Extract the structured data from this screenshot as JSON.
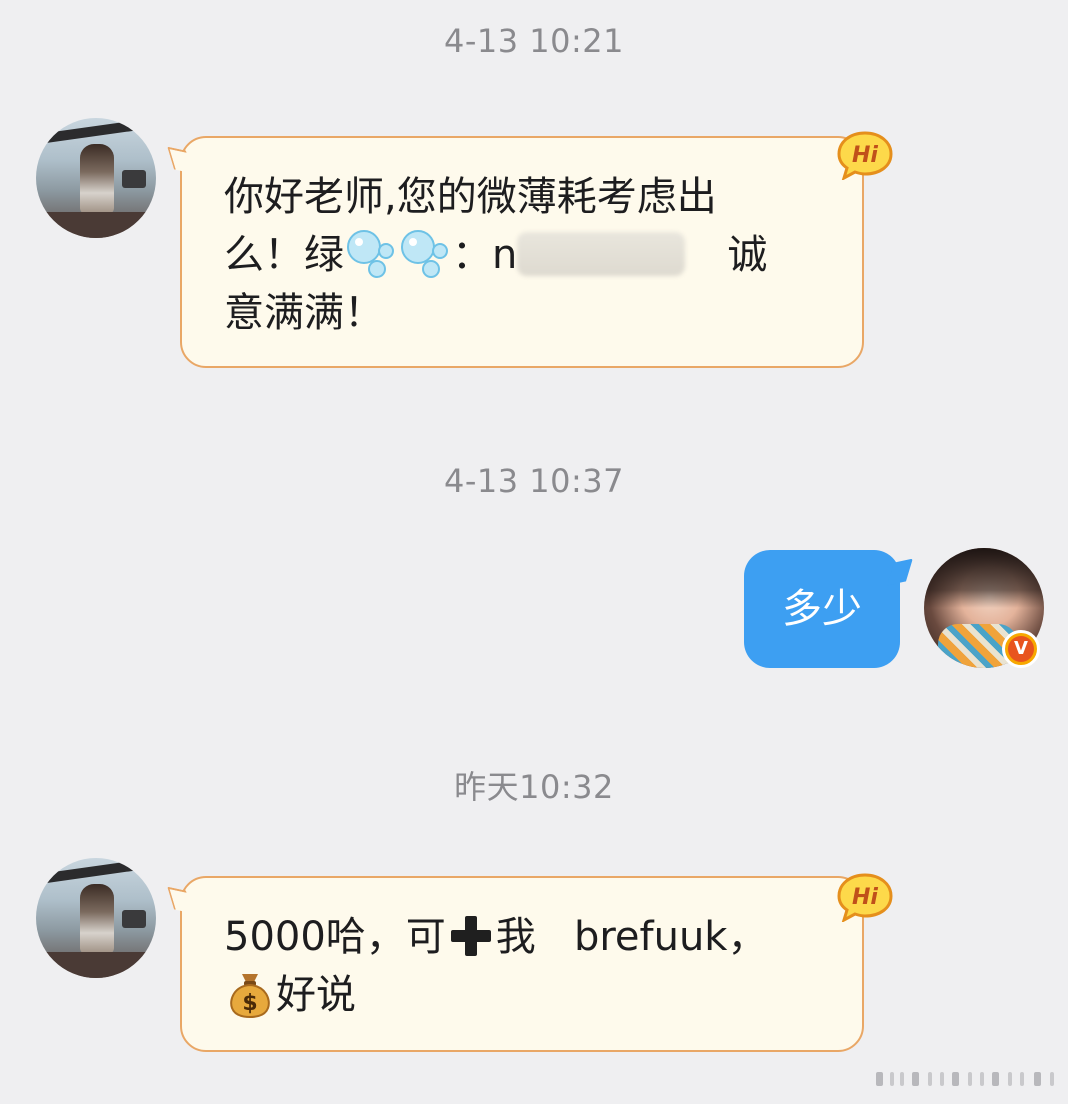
{
  "timestamps": [
    "4-13 10:21",
    "4-13 10:37",
    "昨天10:32"
  ],
  "messages": {
    "m1": {
      "line1": "你好老师,您的微薄耗考虑出",
      "line2_a": "么！绿",
      "line2_b": "：n",
      "line2_c": "诚",
      "line3": "意满满！"
    },
    "m2": {
      "text": "多少"
    },
    "m3": {
      "line1_a": "5000哈，可",
      "line1_b": "我   brefuuk，",
      "line2": "好说"
    }
  },
  "badges": {
    "hi": "Hi",
    "verified": "V"
  },
  "icons": {
    "avatar_left": "user-avatar",
    "avatar_right": "self-avatar",
    "hi_sticker": "hi-speech-icon",
    "bubbles": "bubbles-emoji",
    "plus": "heavy-plus-emoji",
    "money_bag": "money-bag-emoji",
    "verified": "verified-v-badge"
  },
  "colors": {
    "background": "#efeff1",
    "incoming_bubble": "#fefaec",
    "incoming_border": "#e9a766",
    "outgoing_bubble": "#3d9ff2",
    "timestamp": "#8a8a8e",
    "verified_badge": "#f7a800"
  }
}
